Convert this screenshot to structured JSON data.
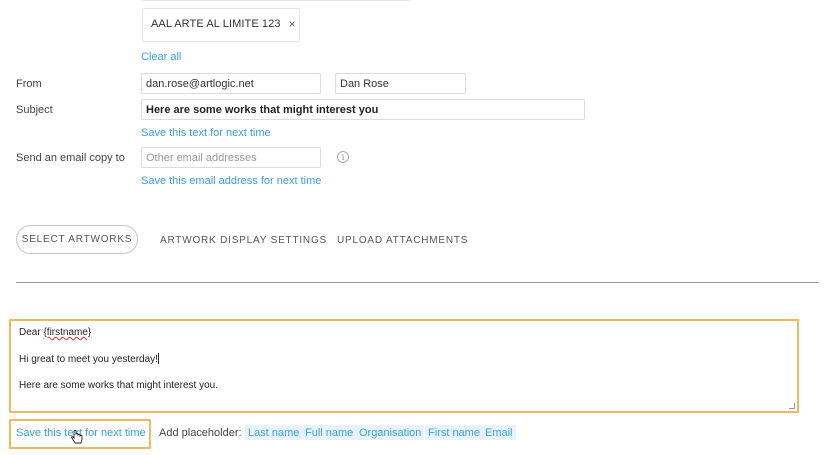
{
  "recipients": {
    "chip_label": "AAL ARTE AL LIMITE 123",
    "chip_remove": "×",
    "clear_all": "Clear all"
  },
  "from": {
    "label": "From",
    "email_value": "dan.rose@artlogic.net",
    "name_value": "Dan Rose"
  },
  "subject": {
    "label": "Subject",
    "value": "Here are some works that might interest you",
    "save_link": "Save this text for next time"
  },
  "copy": {
    "label": "Send an email copy to",
    "placeholder": "Other email addresses",
    "info_glyph": "i",
    "save_link": "Save this email address for next time"
  },
  "tabs": [
    {
      "label": "SELECT ARTWORKS"
    },
    {
      "label": "ARTWORK DISPLAY SETTINGS"
    },
    {
      "label": "UPLOAD ATTACHMENTS"
    }
  ],
  "editor": {
    "line1_prefix": "Dear ",
    "line1_placeholder": "{firstname}",
    "line2": "Hi great to meet you yesterday!",
    "line3": "Here are some works that might interest you."
  },
  "footer": {
    "save_link": "Save this text for next time",
    "add_placeholder_label": "Add placeholder:",
    "placeholders": [
      "Last name",
      "Full name",
      "Organisation",
      "First name",
      "Email"
    ]
  },
  "colors": {
    "accent_link": "#3aa0d5",
    "highlight_border": "#f0b860",
    "tag_background": "#e7f2f9"
  }
}
